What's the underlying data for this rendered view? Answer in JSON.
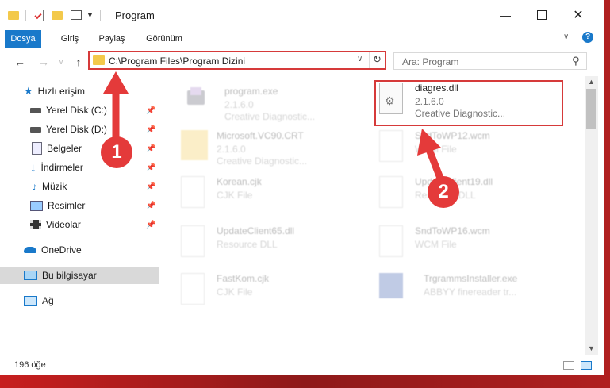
{
  "window": {
    "title": "Program"
  },
  "ribbon": {
    "tabs": [
      "Dosya",
      "Giriş",
      "Paylaş",
      "Görünüm"
    ]
  },
  "address": {
    "path": "C:\\Program Files\\Program Dizini"
  },
  "search": {
    "placeholder": "Ara: Program"
  },
  "sidebar": {
    "items": [
      {
        "label": "Hızlı erişim",
        "icon": "star-icon"
      },
      {
        "label": "Yerel Disk (C:)",
        "icon": "drive-icon",
        "pinned": true
      },
      {
        "label": "Yerel Disk (D:)",
        "icon": "drive-icon",
        "pinned": true
      },
      {
        "label": "Belgeler",
        "icon": "documents-icon",
        "pinned": true
      },
      {
        "label": "İndirmeler",
        "icon": "download-icon",
        "pinned": true
      },
      {
        "label": "Müzik",
        "icon": "music-icon",
        "pinned": true
      },
      {
        "label": "Resimler",
        "icon": "pictures-icon",
        "pinned": true
      },
      {
        "label": "Videolar",
        "icon": "video-icon",
        "pinned": true
      },
      {
        "label": "OneDrive",
        "icon": "cloud-icon"
      },
      {
        "label": "Bu bilgisayar",
        "icon": "computer-icon",
        "selected": true
      },
      {
        "label": "Ağ",
        "icon": "network-icon"
      }
    ]
  },
  "files": [
    {
      "name": "program.exe",
      "version": "2.1.6.0",
      "type": "Creative Diagnostic..."
    },
    {
      "name": "diagres.dll",
      "version": "2.1.6.0",
      "type": "Creative Diagnostic..."
    },
    {
      "name": "Microsoft.VC90.CRT",
      "version": "2.1.6.0",
      "type": "Creative Diagnostic..."
    },
    {
      "name": "SndToWP12.wcm",
      "version": "",
      "type": "WCM File"
    },
    {
      "name": "Korean.cjk",
      "version": "",
      "type": "CJK File"
    },
    {
      "name": "UpdateClient19.dll",
      "version": "",
      "type": "Resource DLL"
    },
    {
      "name": "UpdateClient65.dll",
      "version": "",
      "type": "Resource DLL"
    },
    {
      "name": "SndToWP16.wcm",
      "version": "",
      "type": "WCM File"
    },
    {
      "name": "FastKom.cjk",
      "version": "",
      "type": "CJK File"
    },
    {
      "name": "TrgrammsInstaller.exe",
      "version": "",
      "type": "ABBYY finereader tr..."
    }
  ],
  "status": {
    "count": "196 öğe"
  },
  "annotations": {
    "step1": "1",
    "step2": "2"
  },
  "colors": {
    "accent": "#1979ca",
    "highlight": "#d63a3a"
  }
}
